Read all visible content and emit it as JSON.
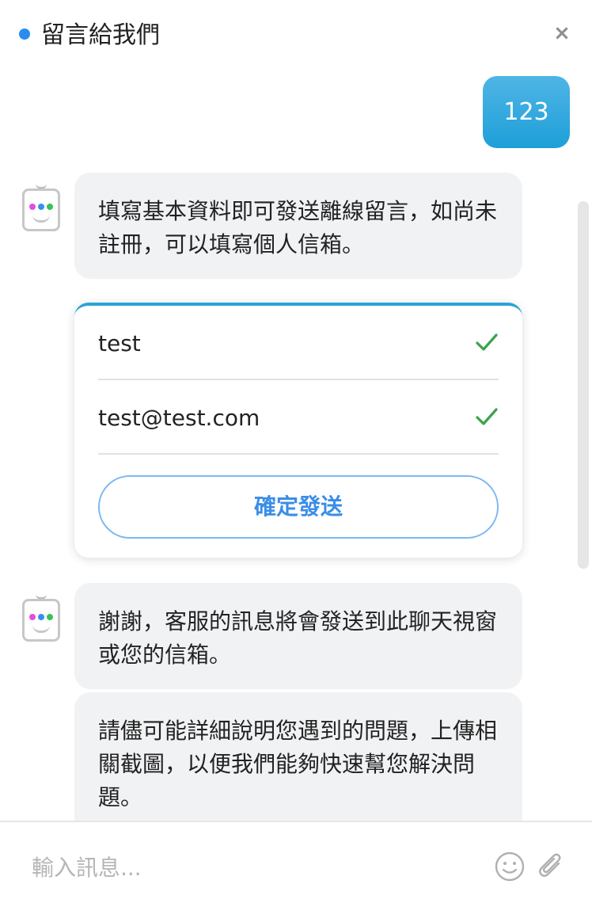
{
  "header": {
    "title": "留言給我們",
    "close_icon": "close-icon"
  },
  "colors": {
    "status_dot": "#2b8cf0",
    "user_bubble": "#22a1d9",
    "check": "#3aa34a",
    "send_button_text": "#3a8ee6"
  },
  "messages": {
    "user_message": "123",
    "bot_intro": "填寫基本資料即可發送離線留言，如尚未註冊，可以填寫個人信箱。",
    "bot_thanks": "謝謝，客服的訊息將會發送到此聊天視窗或您的信箱。",
    "bot_instructions": "請儘可能詳細說明您遇到的問題，上傳相關截圖，以便我們能夠快速幫您解決問題。"
  },
  "form": {
    "name_value": "test",
    "email_value": "test@test.com",
    "send_label": "確定發送"
  },
  "composer": {
    "placeholder": "輸入訊息...",
    "emoji_icon": "smiley-icon",
    "attach_icon": "paperclip-icon"
  }
}
